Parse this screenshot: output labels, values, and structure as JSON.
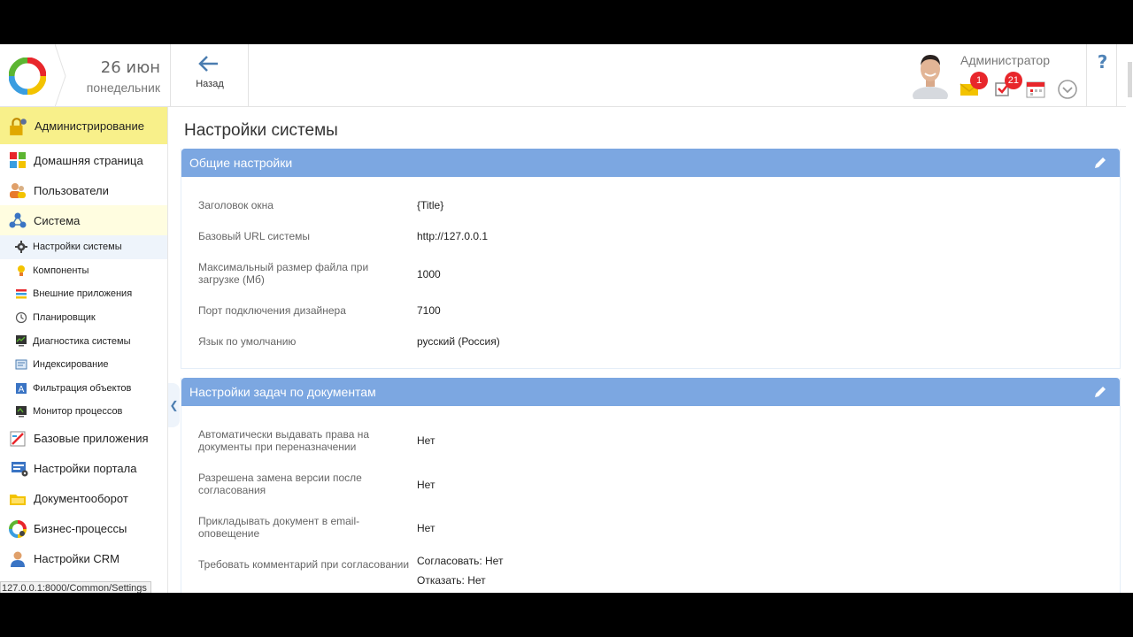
{
  "header": {
    "date_day": "26 июн",
    "date_weekday": "понедельник",
    "back_label": "Назад",
    "user_name": "Администратор",
    "messages_badge": "1",
    "tasks_badge": "21",
    "help_icon": "?"
  },
  "sidebar": {
    "items": [
      {
        "label": "Администрирование",
        "icon": "admin-lock-icon"
      },
      {
        "label": "Домашняя страница",
        "icon": "home-tiles-icon"
      },
      {
        "label": "Пользователи",
        "icon": "users-icon"
      },
      {
        "label": "Система",
        "icon": "system-network-icon"
      },
      {
        "label": "Настройки системы",
        "icon": "gear-icon"
      },
      {
        "label": "Компоненты",
        "icon": "components-icon"
      },
      {
        "label": "Внешние приложения",
        "icon": "external-apps-icon"
      },
      {
        "label": "Планировщик",
        "icon": "clock-icon"
      },
      {
        "label": "Диагностика системы",
        "icon": "diagnostics-icon"
      },
      {
        "label": "Индексирование",
        "icon": "index-icon"
      },
      {
        "label": "Фильтрация объектов",
        "icon": "filter-icon"
      },
      {
        "label": "Монитор процессов",
        "icon": "monitor-icon"
      },
      {
        "label": "Базовые приложения",
        "icon": "base-apps-icon"
      },
      {
        "label": "Настройки портала",
        "icon": "portal-settings-icon"
      },
      {
        "label": "Документооборот",
        "icon": "folder-icon"
      },
      {
        "label": "Бизнес-процессы",
        "icon": "business-process-icon"
      },
      {
        "label": "Настройки CRM",
        "icon": "crm-icon"
      }
    ]
  },
  "status_url": "127.0.0.1:8000/Common/Settings",
  "page_title": "Настройки системы",
  "panels": [
    {
      "title": "Общие настройки",
      "rows": [
        {
          "key": "Заголовок окна",
          "value": "{Title}"
        },
        {
          "key": "Базовый URL системы",
          "value": "http://127.0.0.1"
        },
        {
          "key": "Максимальный размер файла при загрузке (Мб)",
          "value": "1000"
        },
        {
          "key": "Порт подключения дизайнера",
          "value": "7100"
        },
        {
          "key": "Язык по умолчанию",
          "value": "русский (Россия)"
        }
      ]
    },
    {
      "title": "Настройки задач по документам",
      "rows": [
        {
          "key": "Автоматически выдавать права на документы при переназначении",
          "value": "Нет"
        },
        {
          "key": "Разрешена замена версии после согласования",
          "value": "Нет"
        },
        {
          "key": "Прикладывать документ в email-оповещение",
          "value": "Нет"
        },
        {
          "key": "Требовать комментарий при согласовании",
          "value": "Согласовать: Нет",
          "value2": "Отказать: Нет"
        }
      ]
    }
  ],
  "colors": {
    "panel_header": "#7ca7e1",
    "active_nav": "#f8f08a",
    "badge": "#e8262b"
  }
}
